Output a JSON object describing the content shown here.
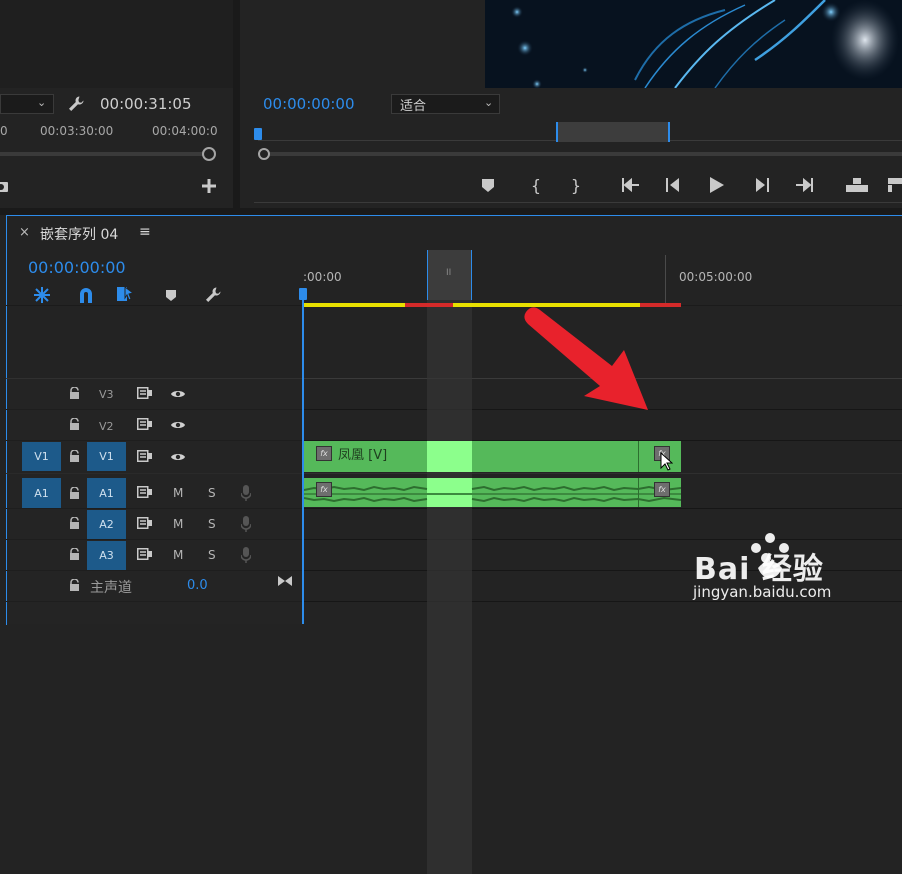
{
  "source_monitor": {
    "timecode": "00:00:31:05",
    "ruler_ticks": [
      "0",
      "00:03:30:00",
      "00:04:00:0"
    ]
  },
  "program_monitor": {
    "timecode": "00:00:00:00",
    "fit_select": "适合"
  },
  "timeline": {
    "close_glyph": "×",
    "sequence_name": "嵌套序列 04",
    "menu_glyph": "≡",
    "timecode": "00:00:00:00",
    "ruler_labels": [
      ":00:00",
      "00:05:00:00"
    ],
    "playhead_label": "II",
    "tracks": {
      "v3": "V3",
      "v2": "V2",
      "v1_source": "V1",
      "v1": "V1",
      "a1_source": "A1",
      "a1": "A1",
      "a2": "A2",
      "a3": "A3",
      "mute": "M",
      "solo": "S"
    },
    "master": {
      "label": "主声道",
      "value": "0.0"
    },
    "clips": {
      "video_clip_name": "凤凰 [V]",
      "fx": "fx"
    }
  },
  "watermark": {
    "brand": "Bai 经验",
    "url": "jingyan.baidu.com"
  },
  "colors": {
    "accent_blue": "#2d8ceb",
    "clip_green": "#55b95a",
    "clip_green_light": "#8cff8c",
    "annotation_red": "#e8222c",
    "ruler_yellow": "#e8e000",
    "ruler_red": "#d42a2a"
  }
}
